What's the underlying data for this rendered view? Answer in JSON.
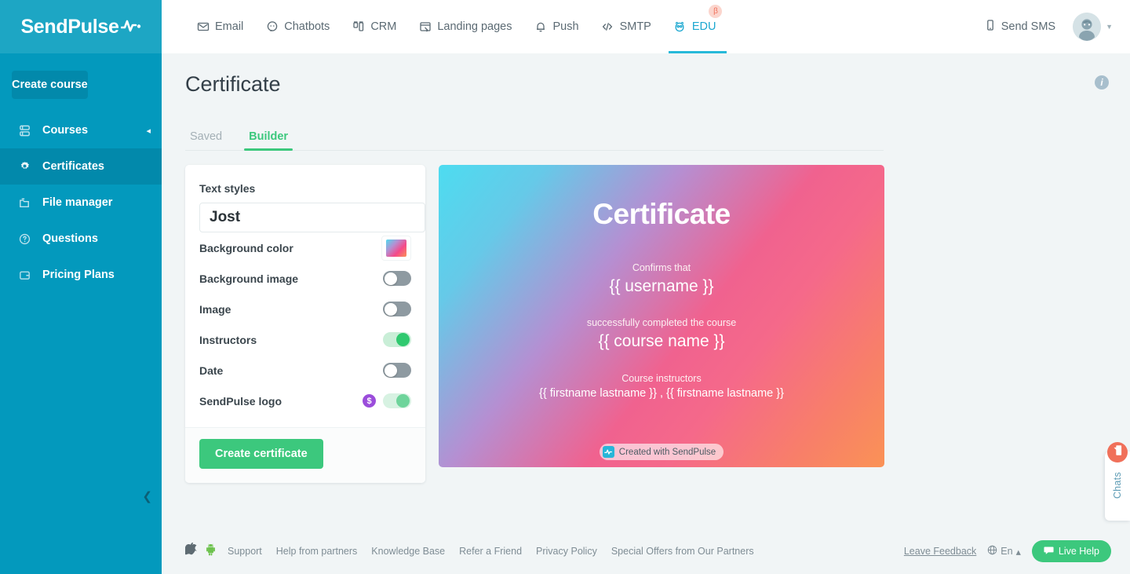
{
  "brand": {
    "name": "SendPulse",
    "logo_icon": "pulse-logo-icon"
  },
  "sidebar": {
    "create_course_label": "Create course",
    "collapse_icon": "chevron-left-icon",
    "items": [
      {
        "label": "Courses",
        "icon": "courses-icon",
        "active": false,
        "caret": "◂"
      },
      {
        "label": "Certificates",
        "icon": "certificate-gear-icon",
        "active": true
      },
      {
        "label": "File manager",
        "icon": "folder-icon",
        "active": false
      },
      {
        "label": "Questions",
        "icon": "question-circle-icon",
        "active": false
      },
      {
        "label": "Pricing Plans",
        "icon": "wallet-icon",
        "active": false
      }
    ]
  },
  "header": {
    "nav": [
      {
        "label": "Email",
        "icon": "envelope-icon",
        "active": false
      },
      {
        "label": "Chatbots",
        "icon": "chat-bubble-icon",
        "active": false
      },
      {
        "label": "CRM",
        "icon": "crm-columns-icon",
        "active": false
      },
      {
        "label": "Landing pages",
        "icon": "landing-page-icon",
        "active": false
      },
      {
        "label": "Push",
        "icon": "bell-icon",
        "active": false
      },
      {
        "label": "SMTP",
        "icon": "code-brackets-icon",
        "active": false
      },
      {
        "label": "EDU",
        "icon": "edu-owl-icon",
        "active": true,
        "badge": "β"
      }
    ],
    "send_sms_label": "Send SMS",
    "send_sms_icon": "mobile-phone-icon",
    "avatar_icon": "user-avatar",
    "avatar_chevron_icon": "chevron-down-icon"
  },
  "main": {
    "title": "Certificate",
    "info_icon": "info-circle-icon",
    "tabs": [
      {
        "label": "Saved",
        "active": false
      },
      {
        "label": "Builder",
        "active": true
      }
    ]
  },
  "panel": {
    "text_styles_label": "Text styles",
    "font_value": "Jost",
    "font_color_swatch": "#ffffff",
    "options": [
      {
        "label": "Background color",
        "control": "swatch",
        "swatch": "gradient",
        "state": ""
      },
      {
        "label": "Background image",
        "control": "toggle",
        "state": "off"
      },
      {
        "label": "Image",
        "control": "toggle",
        "state": "off"
      },
      {
        "label": "Instructors",
        "control": "toggle",
        "state": "on"
      },
      {
        "label": "Date",
        "control": "toggle",
        "state": "off"
      },
      {
        "label": "SendPulse logo",
        "control": "toggle",
        "state": "on-light",
        "badge": "$",
        "badge_color": "#9b4ddb"
      }
    ],
    "create_certificate_label": "Create certificate"
  },
  "certificate": {
    "title": "Certificate",
    "confirms_text": "Confirms that",
    "username_placeholder": "{{ username }}",
    "completed_text": "successfully completed the course",
    "course_placeholder": "{{ course name }}",
    "instructors_label": "Course instructors",
    "instructors_placeholder": "{{ firstname lastname }} , {{ firstname lastname }}",
    "badge_text": "Created with SendPulse",
    "badge_icon": "sendpulse-pulse-icon",
    "gradient_colors": [
      "#4ddcf0",
      "#f5698a",
      "#fa9256"
    ]
  },
  "footer": {
    "store_icons": [
      {
        "name": "apple-icon",
        "glyph": ""
      },
      {
        "name": "android-icon",
        "glyph": "●"
      }
    ],
    "links": [
      "Support",
      "Help from partners",
      "Knowledge Base",
      "Refer a Friend",
      "Privacy Policy",
      "Special Offers from Our Partners"
    ],
    "leave_feedback": "Leave Feedback",
    "language": "En",
    "language_icon": "globe-icon",
    "language_chevron": "▴",
    "live_help": "Live Help",
    "live_help_icon": "chat-bubble-icon"
  },
  "chats_widget": {
    "label": "Chats",
    "badge_icon": "chat-bubble-icon",
    "badge_color": "#f0705a"
  }
}
